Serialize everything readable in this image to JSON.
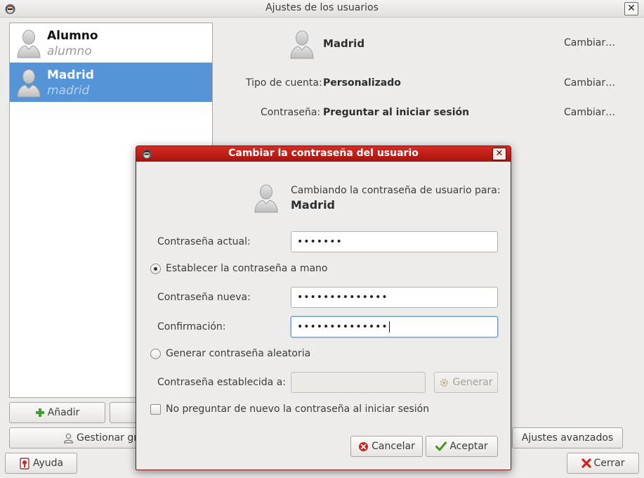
{
  "window": {
    "title": "Ajustes de los usuarios",
    "close_glyph": "✕"
  },
  "users": [
    {
      "name": "Alumno",
      "login": "alumno",
      "selected": false
    },
    {
      "name": "Madrid",
      "login": "madrid",
      "selected": true
    }
  ],
  "details": {
    "user_name": "Madrid",
    "change_link": "Cambiar…",
    "account_type_label": "Tipo de cuenta:",
    "account_type_value": "Personalizado",
    "password_label": "Contraseña:",
    "password_value": "Preguntar al iniciar sesión"
  },
  "buttons": {
    "add": "Añadir",
    "manage_groups": "Gestionar gr",
    "advanced": "Ajustes avanzados",
    "help": "Ayuda",
    "close": "Cerrar"
  },
  "dialog": {
    "title": "Cambiar la contraseña del usuario",
    "close_glyph": "✕",
    "heading": "Cambiando la contraseña de usuario para:",
    "heading_user": "Madrid",
    "current_password_label": "Contraseña actual:",
    "current_password_value": "•••••••",
    "manual_radio_label": "Establecer la contraseña a mano",
    "new_password_label": "Contraseña nueva:",
    "new_password_value": "••••••••••••••",
    "confirm_label": "Confirmación:",
    "confirm_value": "••••••••••••••",
    "random_radio_label": "Generar contraseña aleatoria",
    "set_password_label": "Contraseña establecida a:",
    "set_password_value": "",
    "generate_button": "Generar",
    "no_ask_checkbox_label": "No preguntar de nuevo la contraseña al iniciar sesión",
    "cancel_button": "Cancelar",
    "accept_button": "Aceptar"
  },
  "icons": {
    "app": "user-settings-icon",
    "avatar": "user-avatar-icon",
    "add": "plus-icon",
    "groups": "user-group-icon",
    "help": "help-book-icon",
    "close": "close-x-icon",
    "cancel": "cancel-icon",
    "accept": "checkmark-icon",
    "generate": "gear-icon"
  },
  "colors": {
    "selection": "#5594d6",
    "dialog_titlebar": "#c1201a",
    "add_icon": "#3aa32b",
    "close_icon": "#d3221b",
    "accept_icon": "#3f9a1f"
  }
}
